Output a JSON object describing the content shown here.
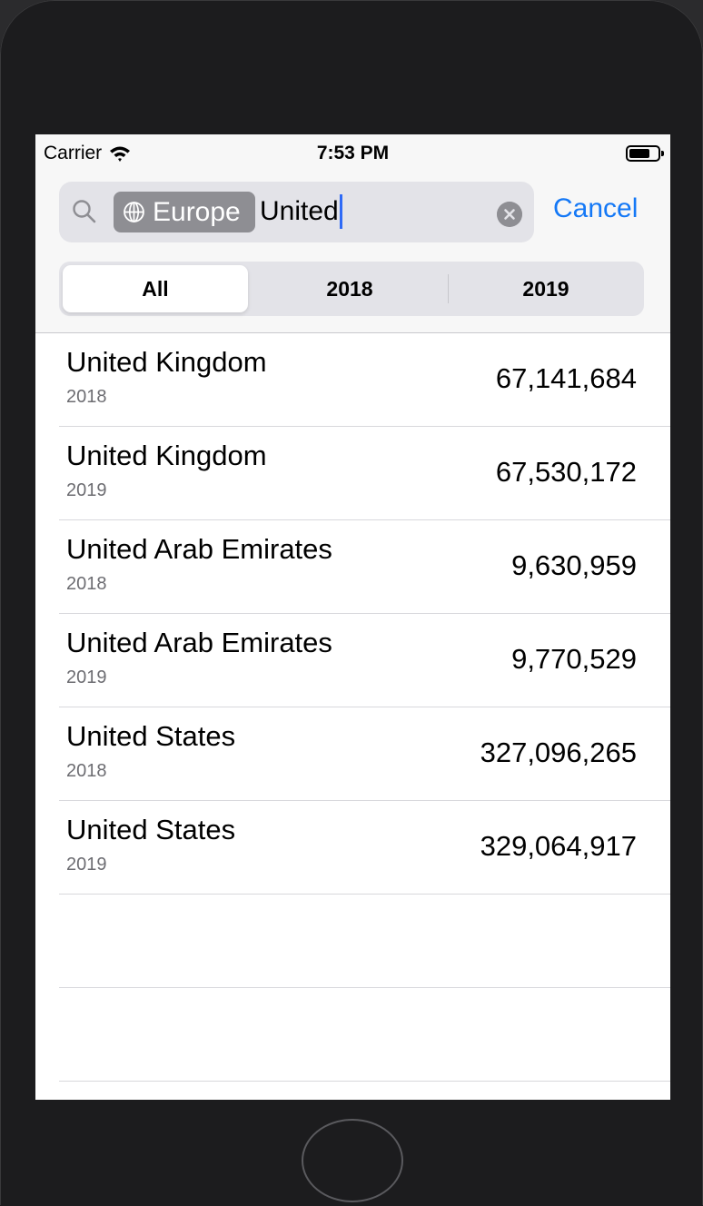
{
  "status_bar": {
    "carrier": "Carrier",
    "time": "7:53 PM"
  },
  "search": {
    "token_label": "Europe",
    "query": "United",
    "cancel_label": "Cancel"
  },
  "scope": {
    "segments": [
      "All",
      "2018",
      "2019"
    ],
    "selected": "All"
  },
  "results": [
    {
      "name": "United Kingdom",
      "year": "2018",
      "population": "67,141,684"
    },
    {
      "name": "United Kingdom",
      "year": "2019",
      "population": "67,530,172"
    },
    {
      "name": "United Arab Emirates",
      "year": "2018",
      "population": "9,630,959"
    },
    {
      "name": "United Arab Emirates",
      "year": "2019",
      "population": "9,770,529"
    },
    {
      "name": "United States",
      "year": "2018",
      "population": "327,096,265"
    },
    {
      "name": "United States",
      "year": "2019",
      "population": "329,064,917"
    }
  ],
  "colors": {
    "accent": "#1478f6",
    "token": "#8e8e93",
    "caret": "#2f6af6"
  }
}
